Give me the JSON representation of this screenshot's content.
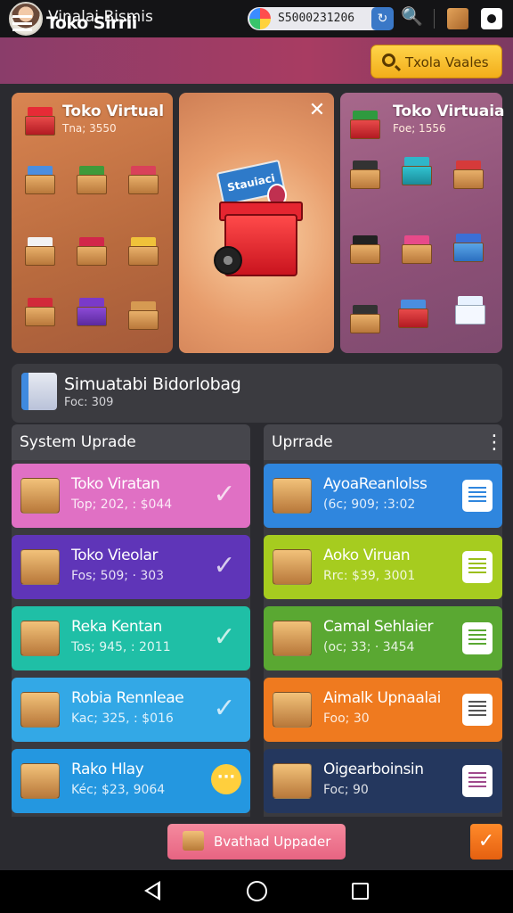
{
  "statusbar": {
    "app_title": "Vinalai Bismis",
    "coin_balance": "S5000231206",
    "icons": [
      "avatar",
      "coin-icon",
      "refresh-icon",
      "key-icon",
      "box-icon",
      "camera-icon"
    ]
  },
  "header": {
    "title": "Toko Sirrii",
    "search_label": "Txola Vaales"
  },
  "showcase": {
    "left": {
      "title": "Toko Virtual",
      "sub": "Tna; 3550"
    },
    "center": {
      "sign": "Stauiaci"
    },
    "right": {
      "title": "Toko Virtuaia",
      "sub": "Foe; 1556"
    }
  },
  "simulation": {
    "title": "Simuatabi Bidorlobag",
    "sub": "Foc: 309"
  },
  "columns": {
    "left_title": "System Uprade",
    "right_title": "Uprrade"
  },
  "left_cards": [
    {
      "title": "Toko Viratan",
      "sub": "Top; 202, : $044",
      "color": "#e070c4",
      "action": "check"
    },
    {
      "title": "Toko Vieolar",
      "sub": "Fos; 509; · 303",
      "color": "#5f35b8",
      "action": "check"
    },
    {
      "title": "Reka Kentan",
      "sub": "Tos; 945, : 2011",
      "color": "#1fbfa6",
      "action": "check"
    },
    {
      "title": "Robia Rennleae",
      "sub": "Kac; 325, : $016",
      "color": "#33a8e6",
      "action": "check"
    },
    {
      "title": "Rako Hlay",
      "sub": "Kéc; $23, 9064",
      "color": "#2497e0",
      "action": "dots"
    }
  ],
  "right_cards": [
    {
      "title": "AyoaReanlolss",
      "sub": "(6c; 909; :3:02",
      "color": "#2f86de",
      "list_color": "#2f86de"
    },
    {
      "title": "Aoko Viruan",
      "sub": "Rrc: $39, 3001",
      "color": "#a6cc1f",
      "list_color": "#9bbf1a"
    },
    {
      "title": "Camal Sehlaier",
      "sub": "(oc; 33; · 3454",
      "color": "#5aa832",
      "list_color": "#5aa832"
    },
    {
      "title": "Aimalk Upnaalai",
      "sub": "Foo; 30",
      "color": "#ef7a1f",
      "list_color": "#555555"
    },
    {
      "title": "Oigearboinsin",
      "sub": "Foc; 90",
      "color": "#24375e",
      "list_color": "#a04a8c"
    }
  ],
  "footer": {
    "button_label": "Bvathad Uppader",
    "confirm_symbol": "✓"
  },
  "colors": {
    "header": "#a83c62",
    "accent": "#ffd44a"
  }
}
